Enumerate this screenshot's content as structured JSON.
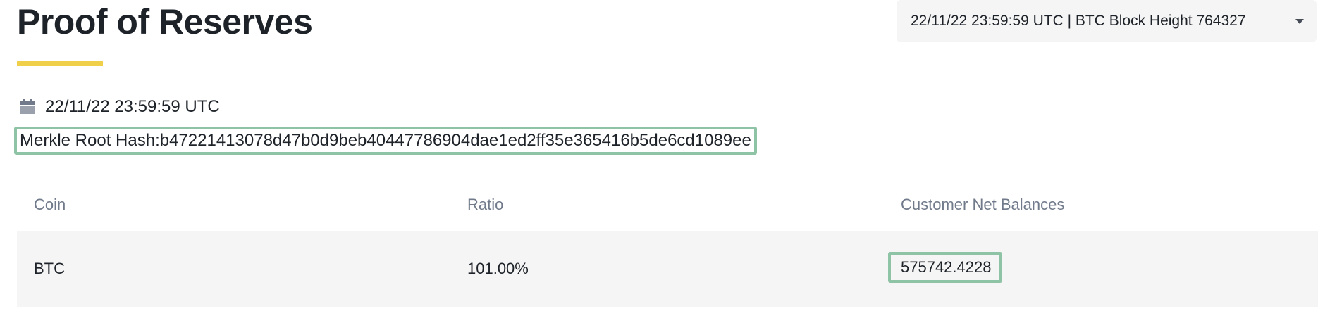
{
  "header": {
    "title": "Proof of Reserves",
    "accent_color": "#f0d04a"
  },
  "snapshot_select": {
    "value": "22/11/22 23:59:59 UTC | BTC Block Height 764327",
    "icon": "caret-down-icon"
  },
  "snapshot": {
    "date_icon": "calendar-icon",
    "date": "22/11/22 23:59:59 UTC",
    "merkle_root_label": "Merkle Root Hash:b47221413078d47b0d9beb40447786904dae1ed2ff35e365416b5de6cd1089ee",
    "highlight_color": "#8fc3a6"
  },
  "table": {
    "columns": [
      "Coin",
      "Ratio",
      "Customer Net Balances"
    ],
    "rows": [
      {
        "coin": "BTC",
        "ratio": "101.00%",
        "customer_net_balance": "575742.4228"
      }
    ]
  }
}
